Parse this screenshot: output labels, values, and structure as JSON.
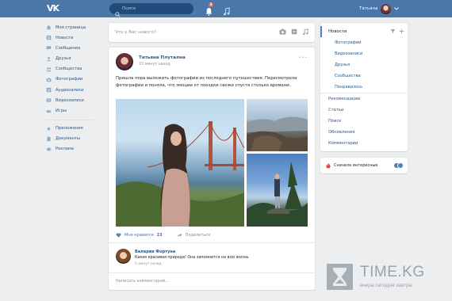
{
  "topbar": {
    "logo": "VK",
    "search_placeholder": "Поиск",
    "notifications_count": "3",
    "user_name": "Татьяна"
  },
  "leftnav": {
    "items": [
      {
        "label": "Моя страница",
        "icon": "home-icon"
      },
      {
        "label": "Новости",
        "icon": "news-icon"
      },
      {
        "label": "Сообщения",
        "icon": "message-icon"
      },
      {
        "label": "Друзья",
        "icon": "friend-icon"
      },
      {
        "label": "Сообщества",
        "icon": "group-icon"
      },
      {
        "label": "Фотографии",
        "icon": "camera-icon"
      },
      {
        "label": "Аудиозаписи",
        "icon": "music-icon"
      },
      {
        "label": "Видеозаписи",
        "icon": "video-icon"
      },
      {
        "label": "Игры",
        "icon": "game-icon"
      }
    ],
    "items2": [
      {
        "label": "Приложения",
        "icon": "app-icon"
      },
      {
        "label": "Документы",
        "icon": "document-icon"
      },
      {
        "label": "Реклама",
        "icon": "ads-icon"
      }
    ]
  },
  "composer": {
    "placeholder": "Что у Вас нового?"
  },
  "post": {
    "author": "Татьяна Плутална",
    "time": "10 минут назад",
    "text": "Пришла пора выложить фотографии из последнего путешествия. Пересмотрела фотографии и поняла, что эмоции от поездки свежи спустя столько времени.",
    "likes_label": "Мне нравится",
    "likes_count": "23",
    "share_label": "Поделиться"
  },
  "comment": {
    "author": "Валерия Фортуна",
    "text": "Какая красивая природа! Она запомнится на всю жизнь",
    "time": "5 минут назад",
    "input_placeholder": "Написать комментарий..."
  },
  "rightnav": {
    "header": "Новости",
    "subitems": [
      "Фотографии",
      "Видеозаписи",
      "Друзья",
      "Сообщества",
      "Понравилось"
    ],
    "items": [
      "Рекомендации",
      "Статьи",
      "Поиск",
      "Обновления",
      "Комментарии"
    ]
  },
  "interest": {
    "label": "Сначала интересные",
    "enabled": true
  },
  "watermark": {
    "title": "TIME.KG",
    "subtitle": "вчера сегодня завтра"
  },
  "colors": {
    "header": "#4a76a8",
    "link": "#2a5885",
    "background": "#edeef0"
  }
}
